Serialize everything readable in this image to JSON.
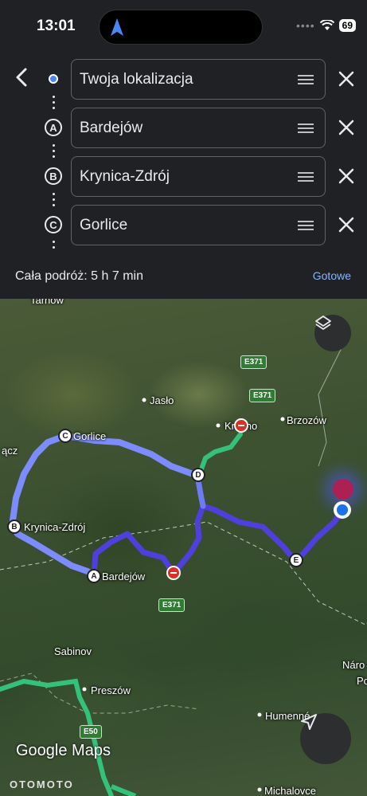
{
  "status_bar": {
    "time": "13:01",
    "battery": "69"
  },
  "route": {
    "stops": [
      {
        "marker": "",
        "name": "Twoja lokalizacja"
      },
      {
        "marker": "A",
        "name": "Bardejów"
      },
      {
        "marker": "B",
        "name": "Krynica-Zdrój"
      },
      {
        "marker": "C",
        "name": "Gorlice"
      }
    ],
    "summary": "Cała podróż: 5 h 7 min",
    "done_label": "Gotowe"
  },
  "map": {
    "places": {
      "tarnow": "Tarnów",
      "jaslo": "Jasło",
      "krosno": "Krosno",
      "brzozow": "Brzozów",
      "gorlice": "Gorlice",
      "lacz": "ącz",
      "krynica": "Krynica-Zdrój",
      "bardejow": "Bardejów",
      "sabinov": "Sabinov",
      "preszow": "Preszów",
      "humenne": "Humenné",
      "michalovce": "Michalovce",
      "naro": "Náro",
      "po": "Po"
    },
    "waypoints": {
      "a": "A",
      "b": "B",
      "c": "C",
      "d": "D",
      "e": "E"
    },
    "road_labels": {
      "e371_top": "E371",
      "e371_mid": "E371",
      "e371_bottom": "E371",
      "e50": "E50"
    },
    "logo": "Google Maps",
    "watermark": "OTOMOTO"
  },
  "colors": {
    "route": "#5b4ee8",
    "route_light": "#7c8cff",
    "alt_route": "#34c27a",
    "accent": "#8ab4f8"
  }
}
